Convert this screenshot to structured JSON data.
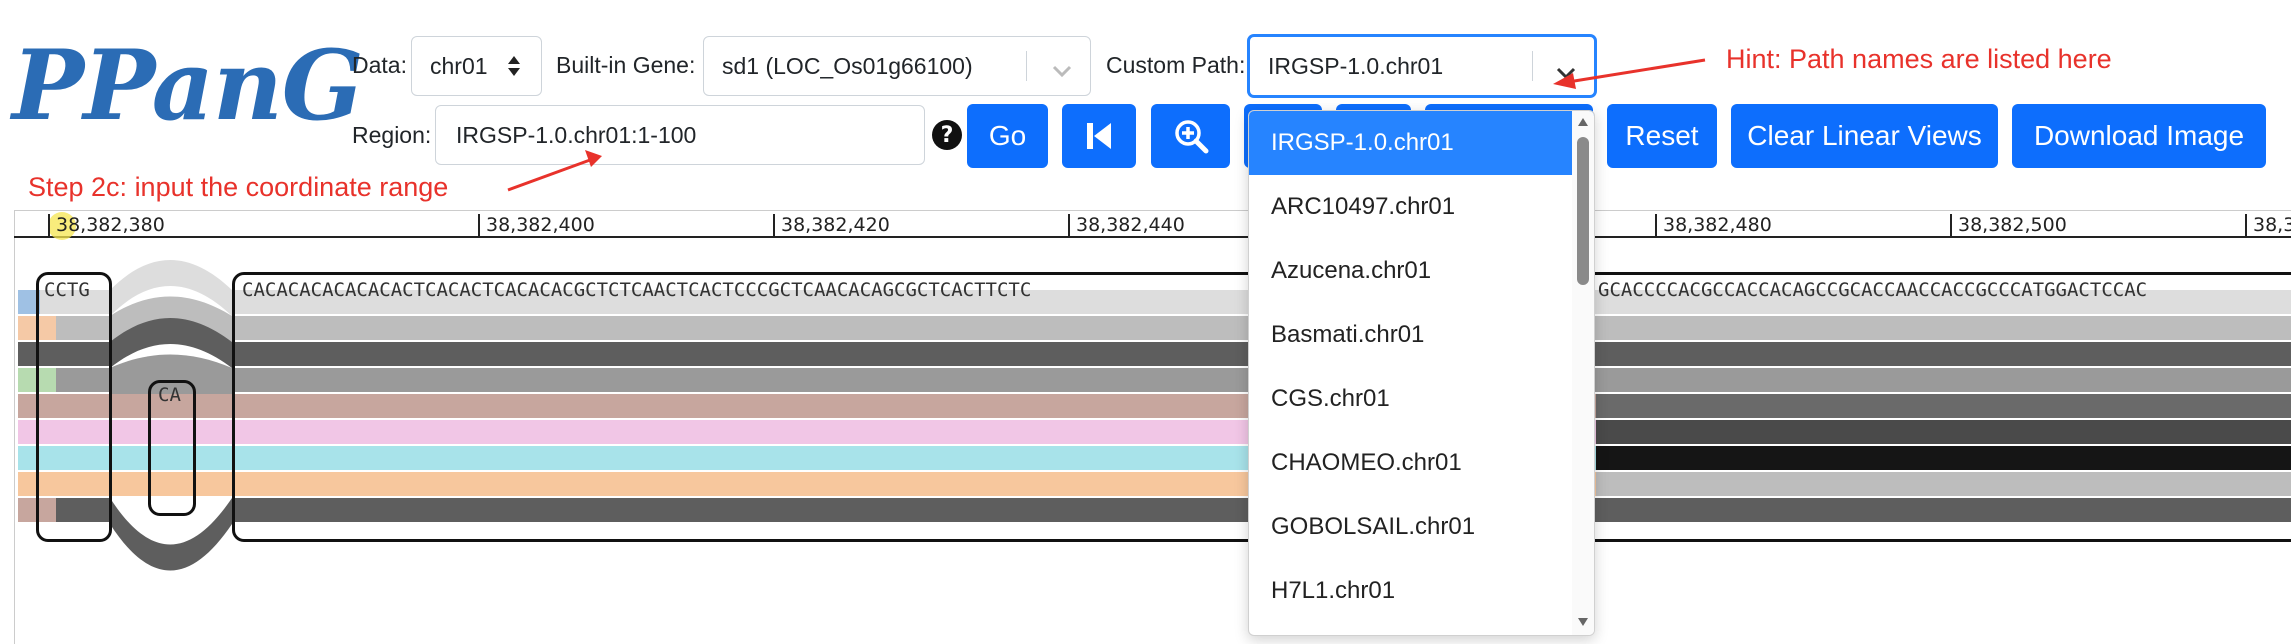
{
  "app": {
    "logo": "PPanG"
  },
  "toolbar": {
    "data_label": "Data:",
    "data_value": "chr01",
    "gene_label": "Built-in Gene:",
    "gene_value": "sd1 (LOC_Os01g66100)",
    "path_label": "Custom Path:",
    "path_value": "IRGSP-1.0.chr01",
    "region_label": "Region:",
    "region_value": "IRGSP-1.0.chr01:1-100",
    "help_glyph": "?",
    "go_label": "Go",
    "reset_label": "Reset",
    "clear_label": "Clear Linear Views",
    "download_label": "Download Image"
  },
  "annotations": {
    "hint": "Hint: Path names are listed here",
    "step": "Step 2c: input the coordinate range"
  },
  "ruler": {
    "ticks": [
      "38,382,380",
      "38,382,400",
      "38,382,420",
      "38,382,440",
      "38,382,480",
      "38,382,500",
      "38,3"
    ]
  },
  "tracks": {
    "node1_seq": "CCTG",
    "node2_seq": "CA",
    "node3_seq_left": "CACACACACACACACTCACACTCACACACGCTCTCAACTCACTCCCGCTCAACACAGCGCTCACTTCTC",
    "node3_seq_right": "GCACCCCACGCCACCACAGCCGCACCAACCACCGCCCATGGACTCCAC"
  },
  "dropdown": {
    "options": [
      "IRGSP-1.0.chr01",
      "ARC10497.chr01",
      "Azucena.chr01",
      "Basmati.chr01",
      "CGS.chr01",
      "CHAOMEO.chr01",
      "GOBOLSAIL.chr01",
      "H7L1.chr01"
    ],
    "selected": "IRGSP-1.0.chr01"
  },
  "colors": {
    "primary": "#0d6efd",
    "focus": "#2684ff",
    "annotation": "#e8322b",
    "logo": "#2b6cb5"
  },
  "icons": [
    "sort-caret-icon",
    "chevron-down-icon",
    "skip-back-icon",
    "zoom-in-icon",
    "help-icon",
    "arrow-icon"
  ]
}
